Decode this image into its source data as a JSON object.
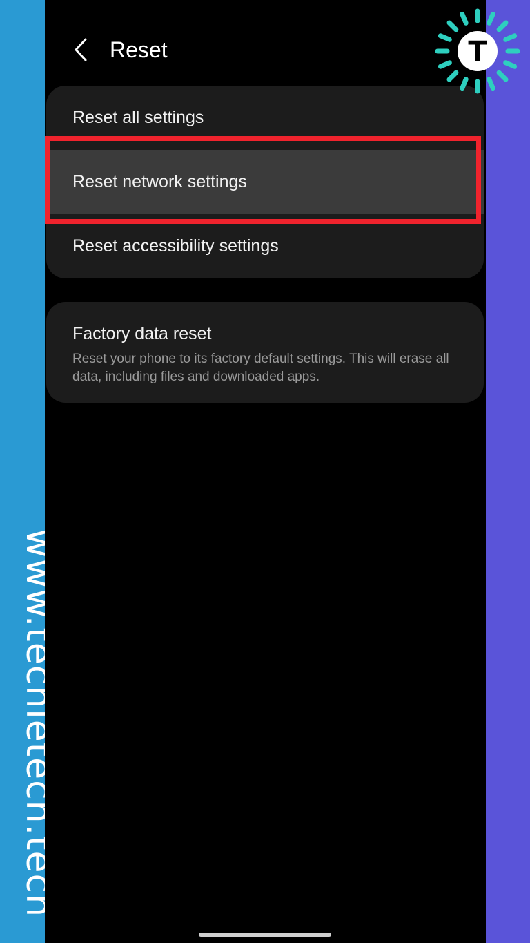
{
  "header": {
    "title": "Reset"
  },
  "reset_options": [
    {
      "label": "Reset all settings"
    },
    {
      "label": "Reset network settings"
    },
    {
      "label": "Reset accessibility settings"
    }
  ],
  "factory_reset": {
    "title": "Factory data reset",
    "description": "Reset your phone to its factory default settings. This will erase all data, including files and downloaded apps."
  },
  "watermark": {
    "text": "www.techietech.tech"
  },
  "logo": {
    "letter": "T",
    "ring_color": "#2ecfbf"
  },
  "colors": {
    "highlight_border": "#f0232d",
    "left_strip": "#2a9ad3",
    "right_strip": "#5a54d9",
    "selected_row": "#3b3b3b"
  }
}
